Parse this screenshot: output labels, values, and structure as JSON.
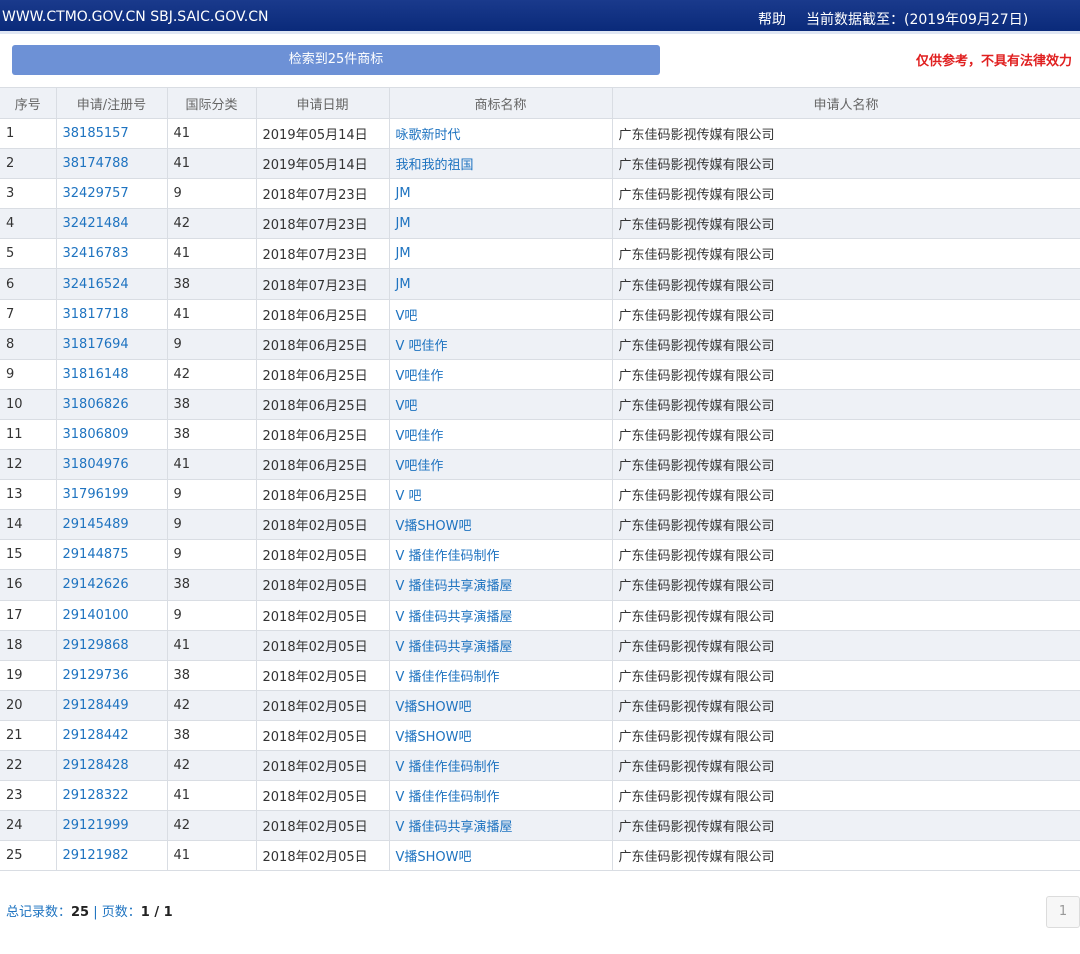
{
  "header": {
    "site": "WWW.CTMO.GOV.CN SBJ.SAIC.GOV.CN",
    "help": "帮助",
    "as_of": "当前数据截至：(2019年09月27日)"
  },
  "result_label": "检索到25件商标",
  "disclaimer": "仅供参考，不具有法律效力",
  "columns": [
    "序号",
    "申请/注册号",
    "国际分类",
    "申请日期",
    "商标名称",
    "申请人名称"
  ],
  "rows": [
    [
      "1",
      "38185157",
      "41",
      "2019年05月14日",
      "咏歌新时代",
      "广东佳码影视传媒有限公司"
    ],
    [
      "2",
      "38174788",
      "41",
      "2019年05月14日",
      "我和我的祖国",
      "广东佳码影视传媒有限公司"
    ],
    [
      "3",
      "32429757",
      "9",
      "2018年07月23日",
      "JM",
      "广东佳码影视传媒有限公司"
    ],
    [
      "4",
      "32421484",
      "42",
      "2018年07月23日",
      "JM",
      "广东佳码影视传媒有限公司"
    ],
    [
      "5",
      "32416783",
      "41",
      "2018年07月23日",
      "JM",
      "广东佳码影视传媒有限公司"
    ],
    [
      "6",
      "32416524",
      "38",
      "2018年07月23日",
      "JM",
      "广东佳码影视传媒有限公司"
    ],
    [
      "7",
      "31817718",
      "41",
      "2018年06月25日",
      "V吧",
      "广东佳码影视传媒有限公司"
    ],
    [
      "8",
      "31817694",
      "9",
      "2018年06月25日",
      "V 吧佳作",
      "广东佳码影视传媒有限公司"
    ],
    [
      "9",
      "31816148",
      "42",
      "2018年06月25日",
      "V吧佳作",
      "广东佳码影视传媒有限公司"
    ],
    [
      "10",
      "31806826",
      "38",
      "2018年06月25日",
      "V吧",
      "广东佳码影视传媒有限公司"
    ],
    [
      "11",
      "31806809",
      "38",
      "2018年06月25日",
      "V吧佳作",
      "广东佳码影视传媒有限公司"
    ],
    [
      "12",
      "31804976",
      "41",
      "2018年06月25日",
      "V吧佳作",
      "广东佳码影视传媒有限公司"
    ],
    [
      "13",
      "31796199",
      "9",
      "2018年06月25日",
      "V 吧",
      "广东佳码影视传媒有限公司"
    ],
    [
      "14",
      "29145489",
      "9",
      "2018年02月05日",
      "V播SHOW吧",
      "广东佳码影视传媒有限公司"
    ],
    [
      "15",
      "29144875",
      "9",
      "2018年02月05日",
      "V 播佳作佳码制作",
      "广东佳码影视传媒有限公司"
    ],
    [
      "16",
      "29142626",
      "38",
      "2018年02月05日",
      "V 播佳码共享演播屋",
      "广东佳码影视传媒有限公司"
    ],
    [
      "17",
      "29140100",
      "9",
      "2018年02月05日",
      "V 播佳码共享演播屋",
      "广东佳码影视传媒有限公司"
    ],
    [
      "18",
      "29129868",
      "41",
      "2018年02月05日",
      "V 播佳码共享演播屋",
      "广东佳码影视传媒有限公司"
    ],
    [
      "19",
      "29129736",
      "38",
      "2018年02月05日",
      "V 播佳作佳码制作",
      "广东佳码影视传媒有限公司"
    ],
    [
      "20",
      "29128449",
      "42",
      "2018年02月05日",
      "V播SHOW吧",
      "广东佳码影视传媒有限公司"
    ],
    [
      "21",
      "29128442",
      "38",
      "2018年02月05日",
      "V播SHOW吧",
      "广东佳码影视传媒有限公司"
    ],
    [
      "22",
      "29128428",
      "42",
      "2018年02月05日",
      "V 播佳作佳码制作",
      "广东佳码影视传媒有限公司"
    ],
    [
      "23",
      "29128322",
      "41",
      "2018年02月05日",
      "V 播佳作佳码制作",
      "广东佳码影视传媒有限公司"
    ],
    [
      "24",
      "29121999",
      "42",
      "2018年02月05日",
      "V 播佳码共享演播屋",
      "广东佳码影视传媒有限公司"
    ],
    [
      "25",
      "29121982",
      "41",
      "2018年02月05日",
      "V播SHOW吧",
      "广东佳码影视传媒有限公司"
    ]
  ],
  "footer": {
    "total_label": "总记录数：",
    "total": "25",
    "separator": " | ",
    "pages_label": "页数：",
    "pages": "1 / 1"
  },
  "pagination": {
    "current": "1"
  },
  "colors": {
    "header_bg": "#0a2a7a",
    "link": "#1e73c0",
    "disclaimer": "#e02020",
    "result_bar": "#6d91d6",
    "row_alt": "#eef1f6"
  }
}
